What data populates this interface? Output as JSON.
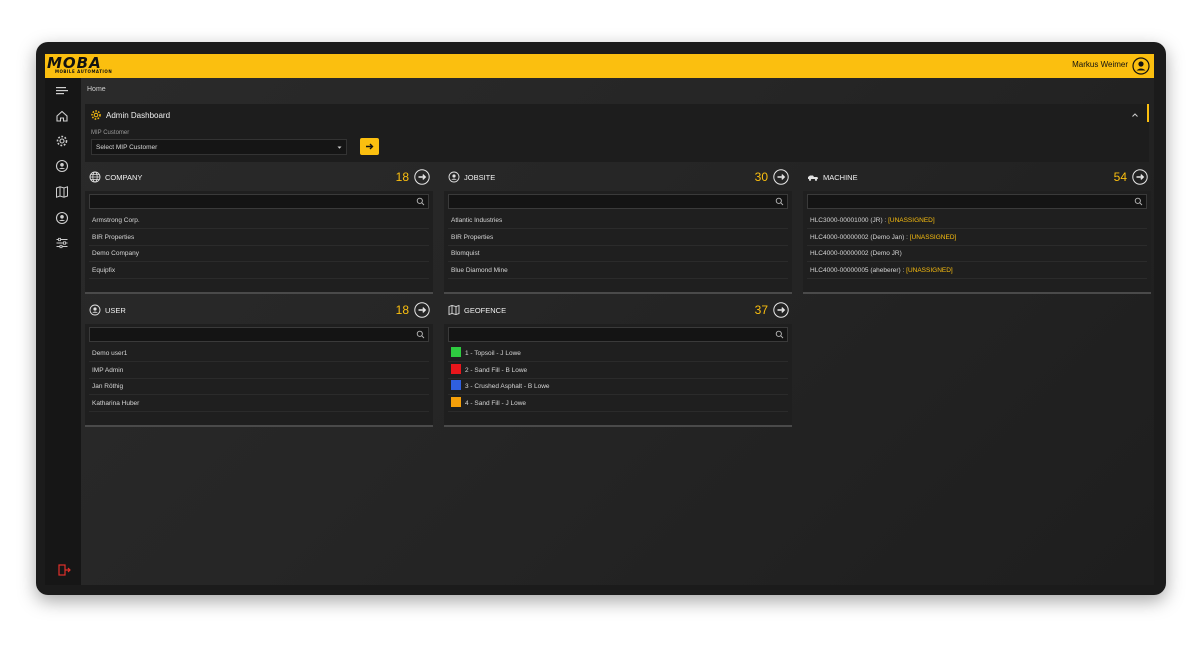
{
  "header": {
    "brand": "MOBA",
    "brand_sub": "MOBILE AUTOMATION",
    "username": "Markus Weimer"
  },
  "breadcrumb": "Home",
  "admin": {
    "title": "Admin Dashboard",
    "mip_label": "MIP Customer",
    "mip_select_value": "Select MIP Customer"
  },
  "colors": {
    "accent": "#fbbf0f",
    "background": "#1f1f1f"
  },
  "sidebar": {
    "items": [
      "menu-icon",
      "home-icon",
      "gear-icon",
      "jobsite-icon",
      "map-icon",
      "user-icon",
      "filter-icon"
    ],
    "logout": "logout-icon"
  },
  "cards": {
    "company": {
      "title": "COMPANY",
      "count": "18",
      "items": [
        "Armstrong Corp.",
        "BIR Properties",
        "Demo Company",
        "Equipfix"
      ]
    },
    "jobsite": {
      "title": "JOBSITE",
      "count": "30",
      "items": [
        "Atlantic Industries",
        "BIR Properties",
        "Blomquist",
        "Blue Diamond Mine"
      ]
    },
    "machine": {
      "title": "MACHINE",
      "count": "54",
      "items": [
        {
          "name": "HLC3000-00001000 (JR) :",
          "status": "[UNASSIGNED]"
        },
        {
          "name": "HLC4000-00000002 (Demo Jan) :",
          "status": "[UNASSIGNED]"
        },
        {
          "name": "HLC4000-00000002 (Demo JR)",
          "status": ""
        },
        {
          "name": "HLC4000-00000005 (aheberer) :",
          "status": "[UNASSIGNED]"
        }
      ]
    },
    "user": {
      "title": "USER",
      "count": "18",
      "items": [
        "Demo user1",
        "IMP Admin",
        "Jan Röthig",
        "Katharina Huber"
      ]
    },
    "geofence": {
      "title": "GEOFENCE",
      "count": "37",
      "items": [
        {
          "label": "1 - Topsoil - J Lowe",
          "color": "#2ecc40"
        },
        {
          "label": "2 - Sand Fill - B Lowe",
          "color": "#e8161b"
        },
        {
          "label": "3 - Crushed Asphalt - B Lowe",
          "color": "#2f5fe0"
        },
        {
          "label": "4 - Sand Fill - J Lowe",
          "color": "#f5a00a"
        }
      ]
    }
  }
}
